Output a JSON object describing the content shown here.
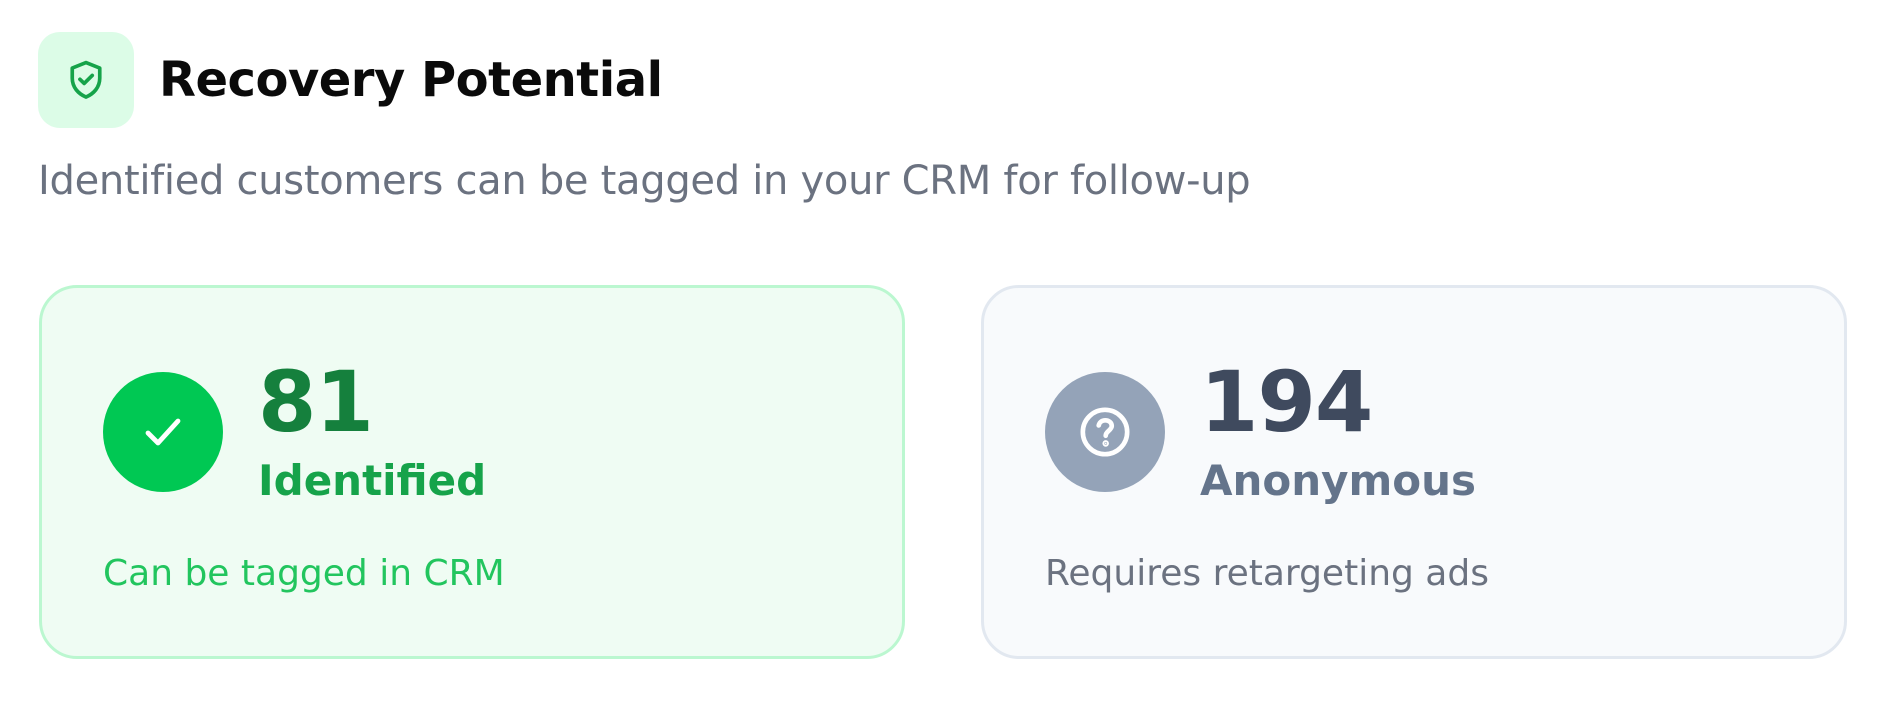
{
  "header": {
    "icon": "shield-check-icon",
    "title": "Recovery Potential",
    "subtitle": "Identified customers can be tagged in your CRM for follow-up"
  },
  "cards": [
    {
      "icon": "check-icon",
      "count": "81",
      "label": "Identified",
      "note": "Can be tagged in CRM",
      "accent": "#00c853"
    },
    {
      "icon": "question-circle-icon",
      "count": "194",
      "label": "Anonymous",
      "note": "Requires retargeting ads",
      "accent": "#94a3b8"
    }
  ],
  "colors": {
    "brand_green": "#16a34a",
    "light_green_bg": "#dcfce7",
    "slate": "#3f4a5e"
  }
}
